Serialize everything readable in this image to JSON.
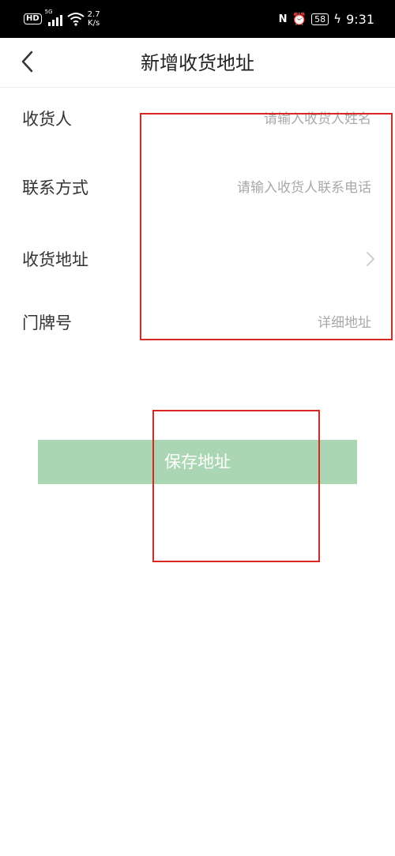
{
  "status_bar": {
    "hd": "HD",
    "network_tag": "5G",
    "speed_value": "2.7",
    "speed_unit": "K/s",
    "nfc": "N",
    "battery": "58",
    "time": "9:31"
  },
  "header": {
    "title": "新增收货地址"
  },
  "form": {
    "receiver": {
      "label": "收货人",
      "placeholder": "请输入收货人姓名"
    },
    "contact": {
      "label": "联系方式",
      "placeholder": "请输入收货人联系电话"
    },
    "address": {
      "label": "收货地址"
    },
    "house_number": {
      "label": "门牌号",
      "placeholder": "详细地址"
    }
  },
  "save_button": {
    "label": "保存地址"
  },
  "colors": {
    "accent": "#abd6b4",
    "annotation": "#d9281f"
  },
  "icons": [
    "back-arrow-icon",
    "chevron-right-icon",
    "wifi-icon",
    "signal-icon",
    "alarm-icon",
    "battery-icon",
    "charging-icon"
  ]
}
